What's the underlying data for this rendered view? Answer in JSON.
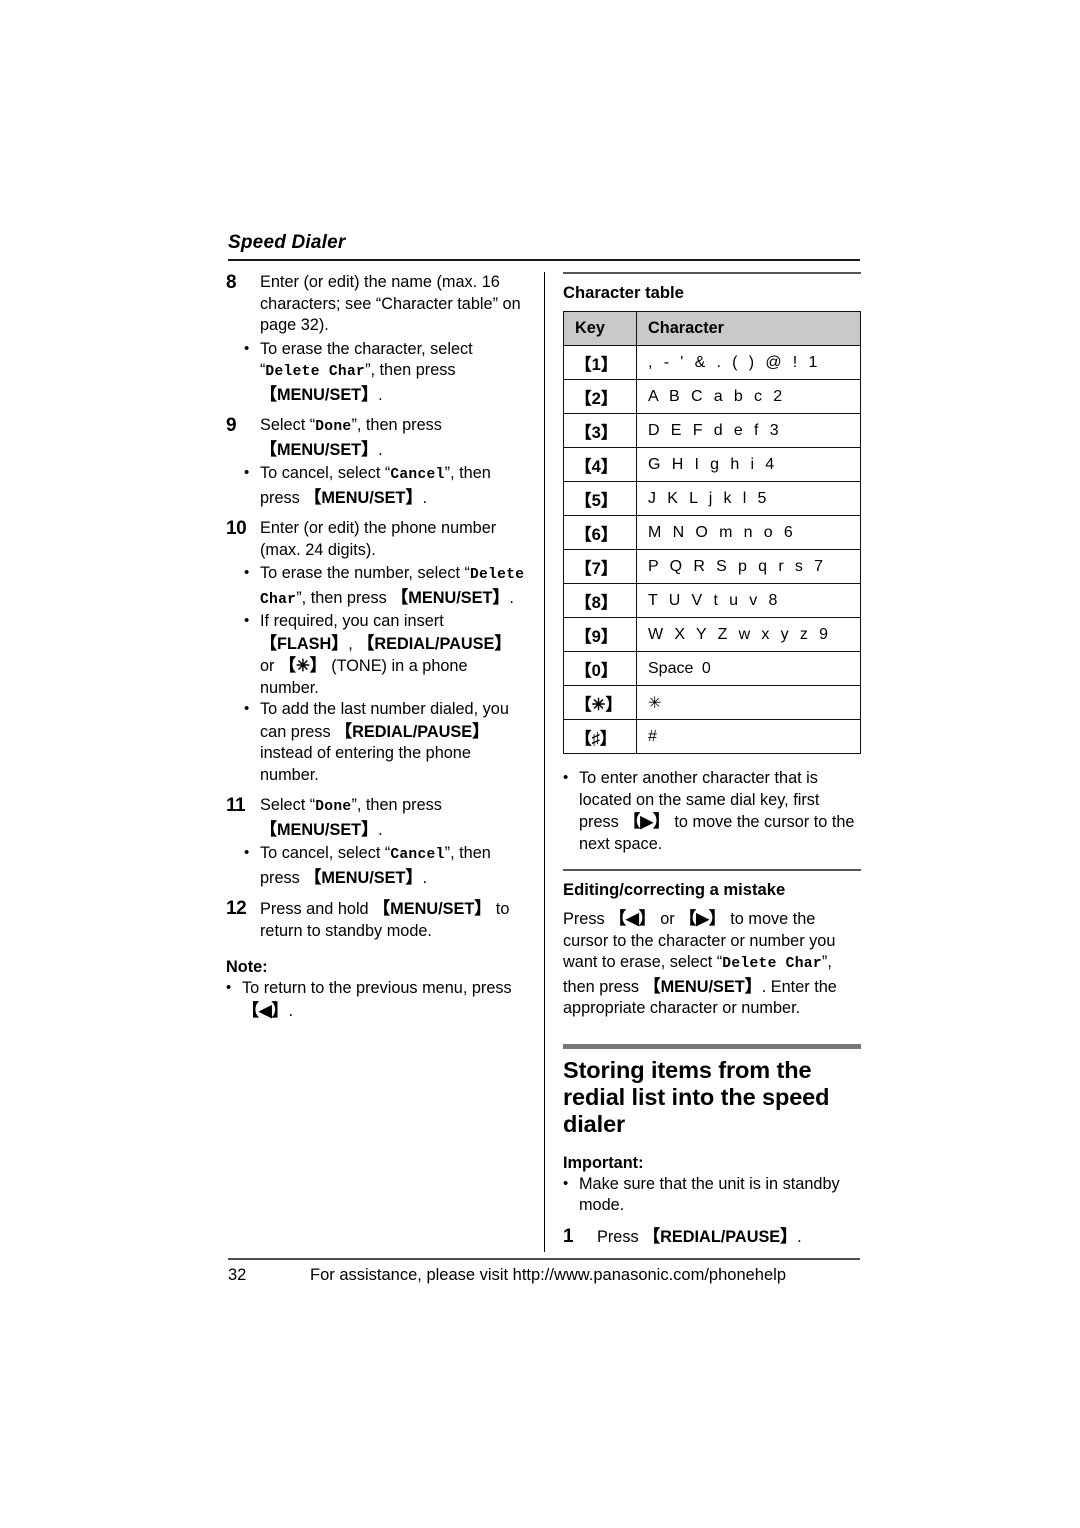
{
  "running_head": "Speed Dialer",
  "left_column": {
    "steps": [
      {
        "num": "8",
        "text": "Enter (or edit) the name (max. 16 characters; see “Character table” on page 32).",
        "bullets": [
          {
            "pre": "To erase the character, select “",
            "mono": "Delete Char",
            "mid": "”, then press ",
            "key": "MENU/SET",
            "post": "."
          }
        ]
      },
      {
        "num": "9",
        "pre": "Select “",
        "mono": "Done",
        "mid": "”, then press ",
        "key": "MENU/SET",
        "post": ".",
        "bullets": [
          {
            "pre": "To cancel, select “",
            "mono": "Cancel",
            "mid": "”, then press ",
            "key": "MENU/SET",
            "post": "."
          }
        ]
      },
      {
        "num": "10",
        "text": "Enter (or edit) the phone number (max. 24 digits).",
        "bullets": [
          {
            "pre": "To erase the number, select “",
            "mono": "Delete Char",
            "mid": "”, then press ",
            "key": "MENU/SET",
            "post": "."
          }
        ]
      }
    ],
    "bullet_flash": {
      "line1": "If required, you can insert ",
      "key1": "FLASH",
      "sep1": ", ",
      "key2": "REDIAL/PAUSE",
      "sep2": " or ",
      "key3": "✳",
      "tail": " (TONE) in a phone number."
    },
    "bullet_redial": {
      "pre": "To add the last number dialed, you can press ",
      "key": "REDIAL/PAUSE",
      "post": " instead of entering the phone number."
    },
    "step11": {
      "num": "11",
      "pre": "Select “",
      "mono": "Done",
      "mid": "”, then press ",
      "key": "MENU/SET",
      "post": ".",
      "bullet": {
        "pre": "To cancel, select “",
        "mono": "Cancel",
        "mid": "”, then press ",
        "key": "MENU/SET",
        "post": "."
      }
    },
    "step12": {
      "num": "12",
      "pre": "Press and hold ",
      "key": "MENU/SET",
      "post": " to return to standby mode."
    },
    "note": {
      "heading": "Note:",
      "pre": "To return to the previous menu, press ",
      "key": "◀",
      "post": "."
    }
  },
  "right_column": {
    "table_title": "Character table",
    "table": {
      "headers": [
        "Key",
        "Character"
      ],
      "rows": [
        {
          "key": "【1】",
          "chars": ", - ' & . ( ) @ ! 1"
        },
        {
          "key": "【2】",
          "chars": "A B C a b c 2"
        },
        {
          "key": "【3】",
          "chars": "D E F d e f 3"
        },
        {
          "key": "【4】",
          "chars": "G H I g h i 4"
        },
        {
          "key": "【5】",
          "chars": "J K L j k l 5"
        },
        {
          "key": "【6】",
          "chars": "M N O m n o 6"
        },
        {
          "key": "【7】",
          "chars": "P Q R S p q r s 7"
        },
        {
          "key": "【8】",
          "chars": "T U V t u v 8"
        },
        {
          "key": "【9】",
          "chars": "W X Y Z w x y z 9"
        },
        {
          "key": "【0】",
          "chars": "Space  0",
          "wordy": true
        },
        {
          "key": "【✳】",
          "chars": "✳"
        },
        {
          "key": "【♯】",
          "chars": "#"
        }
      ]
    },
    "table_note": {
      "pre": "To enter another character that is located on the same dial key, first press ",
      "key": "▶",
      "post": " to move the cursor to the next space."
    },
    "editing": {
      "heading": "Editing/correcting a mistake",
      "pre": "Press ",
      "key1": "◀",
      "mid1": " or ",
      "key2": "▶",
      "mid2": " to move the cursor to the character or number you want to erase, select “",
      "mono": "Delete Char",
      "mid3": "”, then press ",
      "key3": "MENU/SET",
      "post": ". Enter the appropriate character or number."
    },
    "section": {
      "title": "Storing items from the redial list into the speed dialer",
      "important_heading": "Important:",
      "important_bullet": "Make sure that the unit is in standby mode.",
      "step1_num": "1",
      "step1_pre": "Press ",
      "step1_key": "REDIAL/PAUSE",
      "step1_post": "."
    }
  },
  "footer": {
    "page_number": "32",
    "text": "For assistance, please visit http://www.panasonic.com/phonehelp"
  }
}
